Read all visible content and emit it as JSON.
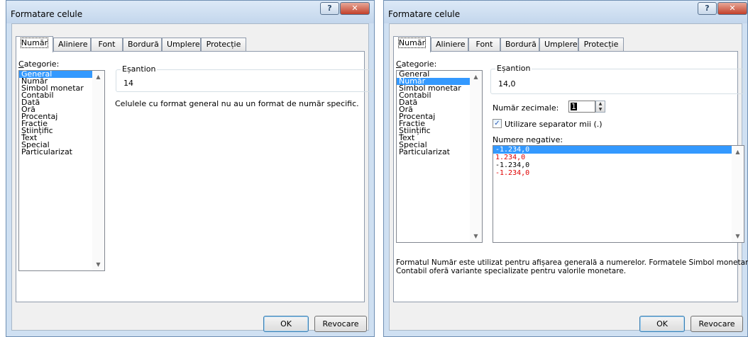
{
  "dialog_left": {
    "title": "Formatare celule",
    "tabs": [
      "Număr",
      "Aliniere",
      "Font",
      "Bordură",
      "Umplere",
      "Protecție"
    ],
    "category_label": "Categorie:",
    "categories": [
      "General",
      "Număr",
      "Simbol monetar",
      "Contabil",
      "Dată",
      "Oră",
      "Procentaj",
      "Fracție",
      "Științific",
      "Text",
      "Special",
      "Particularizat"
    ],
    "selected_category": "General",
    "sample_label": "Eșantion",
    "sample_value": "14",
    "description": "Celulele cu format general nu au un format de număr specific.",
    "ok_label": "OK",
    "cancel_label": "Revocare"
  },
  "dialog_right": {
    "title": "Formatare celule",
    "tabs": [
      "Număr",
      "Aliniere",
      "Font",
      "Bordură",
      "Umplere",
      "Protecție"
    ],
    "category_label": "Categorie:",
    "categories": [
      "General",
      "Număr",
      "Simbol monetar",
      "Contabil",
      "Dată",
      "Oră",
      "Procentaj",
      "Fracție",
      "Științific",
      "Text",
      "Special",
      "Particularizat"
    ],
    "selected_category": "Număr",
    "sample_label": "Eșantion",
    "sample_value": "14,0",
    "decimals_label": "Număr zecimale:",
    "decimals_value": "1",
    "separator_label": "Utilizare separator mii (.)",
    "separator_checked": true,
    "negative_label": "Numere negative:",
    "negative_numbers": [
      "-1.234,0",
      "1.234,0",
      "-1.234,0",
      "-1.234,0"
    ],
    "description_line1": "Formatul Număr este utilizat pentru afișarea generală a numerelor.  Formatele Simbol monetar și",
    "description_line2": "Contabil oferă variante specializate pentru valorile monetare.",
    "ok_label": "OK",
    "cancel_label": "Revocare"
  },
  "colors": {
    "selection": "#3399ff",
    "negative_red": "#e00000",
    "frame": "#cfe0f2"
  }
}
